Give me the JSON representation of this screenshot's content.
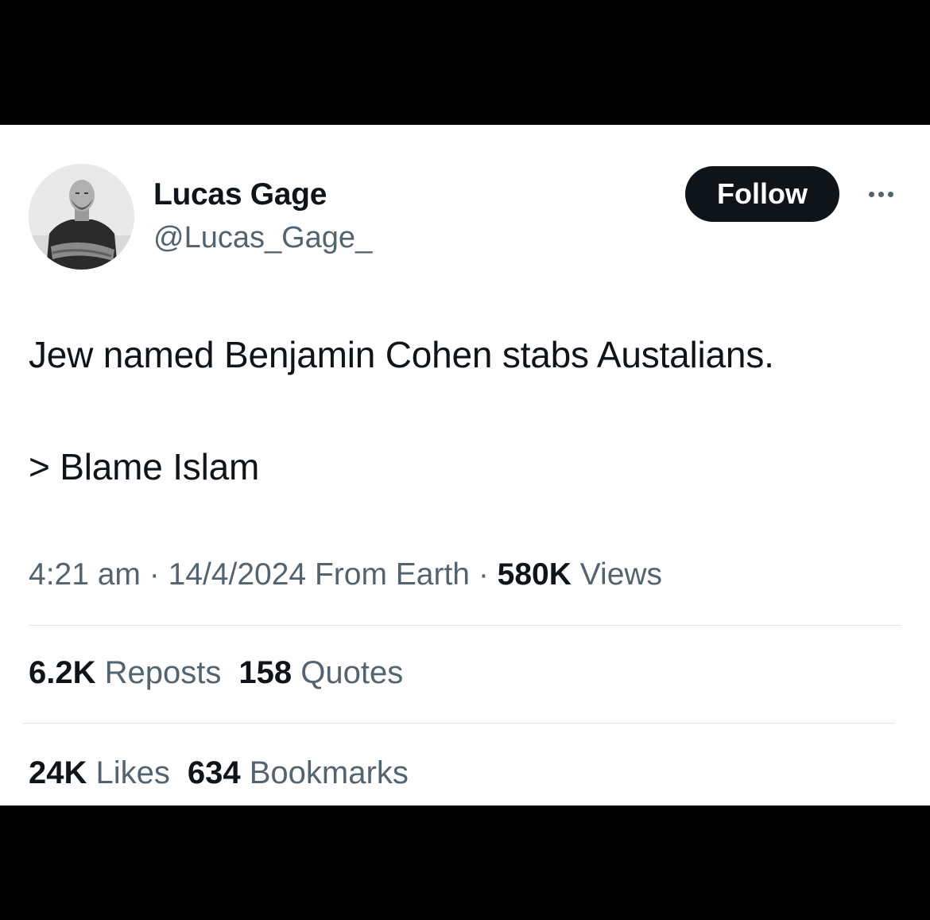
{
  "user": {
    "display_name": "Lucas Gage",
    "handle": "@Lucas_Gage_"
  },
  "follow_label": "Follow",
  "tweet": {
    "line1": "Jew named Benjamin Cohen stabs Austalians.",
    "line2": "> Blame Islam"
  },
  "meta": {
    "time": "4:21 am",
    "sep1": " · ",
    "date": "14/4/2024",
    "source": " From Earth",
    "sep2": " · ",
    "views_count": "580K",
    "views_label": " Views"
  },
  "stats": {
    "reposts_count": "6.2K",
    "reposts_label": " Reposts",
    "quotes_count": "158",
    "quotes_label": " Quotes",
    "likes_count": "24K",
    "likes_label": " Likes",
    "bookmarks_count": "634",
    "bookmarks_label": " Bookmarks"
  },
  "icons": {
    "avatar": "profile-photo",
    "more": "more-horizontal-icon"
  },
  "colors": {
    "text_primary": "#0f1419",
    "text_secondary": "#536471",
    "follow_bg": "#0f1419",
    "divider": "#e1e4e6"
  }
}
